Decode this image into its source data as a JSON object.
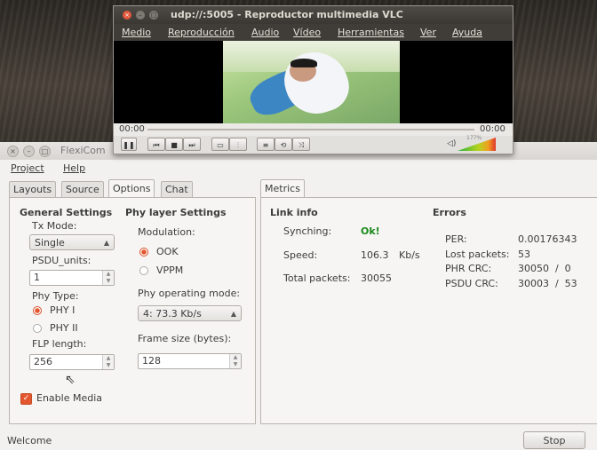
{
  "vlc": {
    "title": "udp://:5005 - Reproductor multimedia VLC",
    "menu": [
      "Medio",
      "Reproducción",
      "Audio",
      "Vídeo",
      "Herramientas",
      "Ver",
      "Ayuda"
    ],
    "time_elapsed": "00:00",
    "time_total": "00:00",
    "volume": "177%"
  },
  "flexicom": {
    "title": "FlexiCom",
    "menu": [
      "Project",
      "Help"
    ],
    "left_tabs": [
      "Layouts",
      "Source",
      "Options",
      "Chat"
    ],
    "right_tabs": [
      "Metrics"
    ],
    "general": {
      "heading": "General Settings",
      "tx_mode_label": "Tx Mode:",
      "tx_mode_value": "Single",
      "psdu_label": "PSDU_units:",
      "psdu_value": "1",
      "phy_type_label": "Phy Type:",
      "phy_options": [
        "PHY I",
        "PHY II"
      ],
      "flp_label": "FLP length:",
      "flp_value": "256",
      "enable_media": "Enable Media"
    },
    "phy": {
      "heading": "Phy layer Settings",
      "modulation_label": "Modulation:",
      "modulation_options": [
        "OOK",
        "VPPM"
      ],
      "mode_label": "Phy operating mode:",
      "mode_value": "4: 73.3 Kb/s",
      "frame_label": "Frame size (bytes):",
      "frame_value": "128"
    },
    "link": {
      "heading": "Link info",
      "synch_label": "Synching:",
      "synch_value": "Ok!",
      "speed_label": "Speed:",
      "speed_value": "106.3",
      "speed_unit": "Kb/s",
      "total_label": "Total packets:",
      "total_value": "30055"
    },
    "errors": {
      "heading": "Errors",
      "per_label": "PER:",
      "per_value": "0.00176343",
      "lost_label": "Lost packets:",
      "lost_value": "53",
      "phr_label": "PHR CRC:",
      "phr_value": "30050  /  0",
      "psdu_label": "PSDU CRC:",
      "psdu_value": "30003  /  53"
    },
    "status": "Welcome",
    "stop_label": "Stop"
  }
}
